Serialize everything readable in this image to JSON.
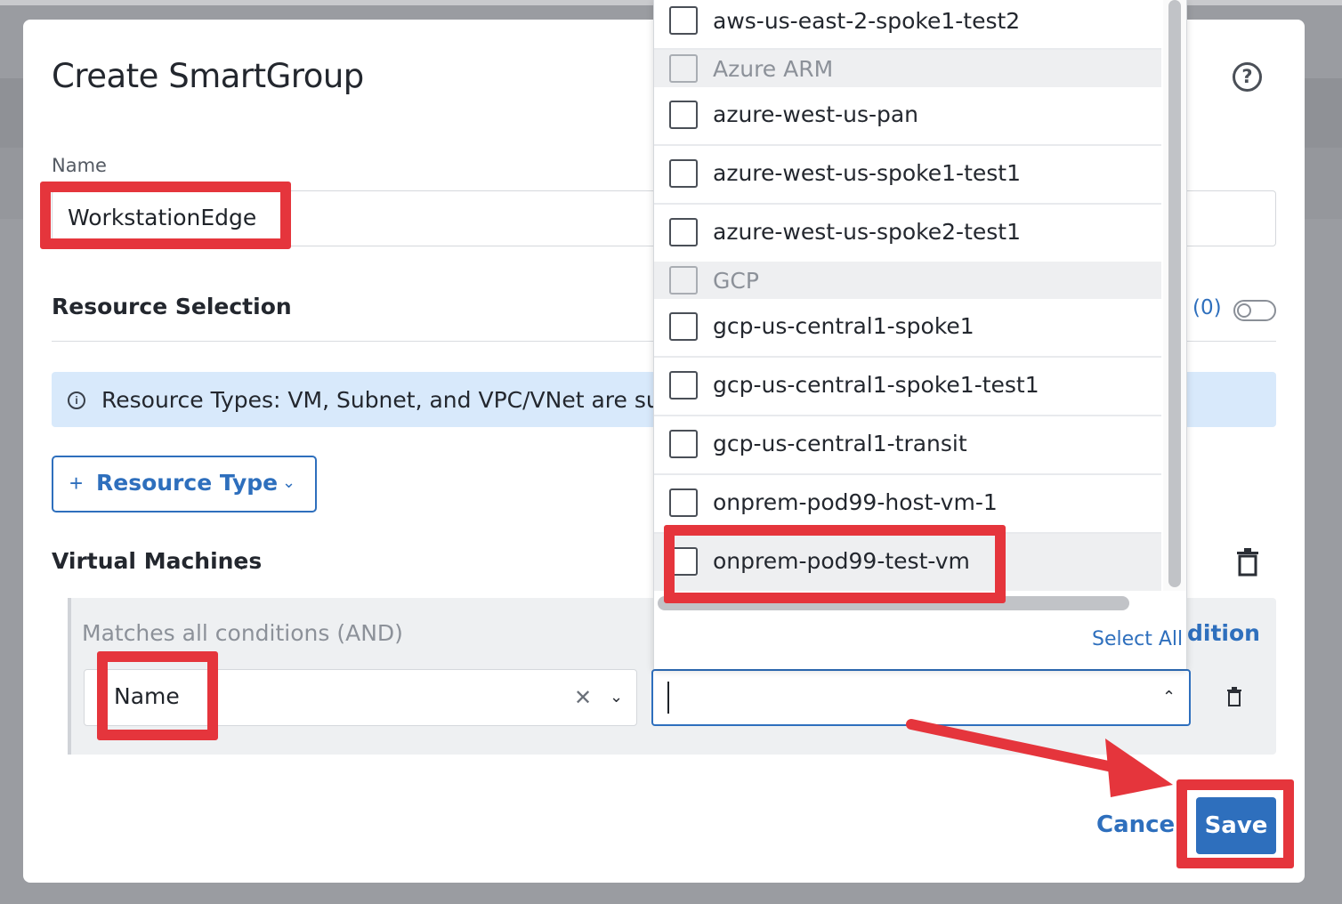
{
  "modal": {
    "title": "Create SmartGroup",
    "help_icon": "question-circle-icon",
    "name_label": "Name",
    "name_value": "WorkstationEdge",
    "resource_selection": {
      "title": "Resource Selection",
      "count": "(0)"
    },
    "info": {
      "icon": "info-circle-icon",
      "text": "Resource Types: VM, Subnet, and VPC/VNet are suppo"
    },
    "resource_type_button": {
      "plus": "+",
      "label": "Resource Type"
    },
    "virtual_machines": {
      "title": "Virtual Machines",
      "match_label": "Matches all conditions (AND)",
      "add_condition_partial": "dition",
      "field_value": "Name"
    },
    "footer": {
      "cancel": "Cancel",
      "save": "Save"
    }
  },
  "dropdown": {
    "items": [
      {
        "label": "aws-us-east-2-spoke1-test2",
        "group": false
      },
      {
        "label": "Azure ARM",
        "group": true
      },
      {
        "label": "azure-west-us-pan",
        "group": false
      },
      {
        "label": "azure-west-us-spoke1-test1",
        "group": false
      },
      {
        "label": "azure-west-us-spoke2-test1",
        "group": false
      },
      {
        "label": "GCP",
        "group": true
      },
      {
        "label": "gcp-us-central1-spoke1",
        "group": false
      },
      {
        "label": "gcp-us-central1-spoke1-test1",
        "group": false
      },
      {
        "label": "gcp-us-central1-transit",
        "group": false
      },
      {
        "label": "onprem-pod99-host-vm-1",
        "group": false
      },
      {
        "label": "onprem-pod99-test-vm",
        "group": false
      }
    ],
    "select_all": "Select All"
  },
  "colors": {
    "accent": "#2e6fbd",
    "annotation": "#e5353c",
    "info_bg": "#d8e9fb"
  }
}
